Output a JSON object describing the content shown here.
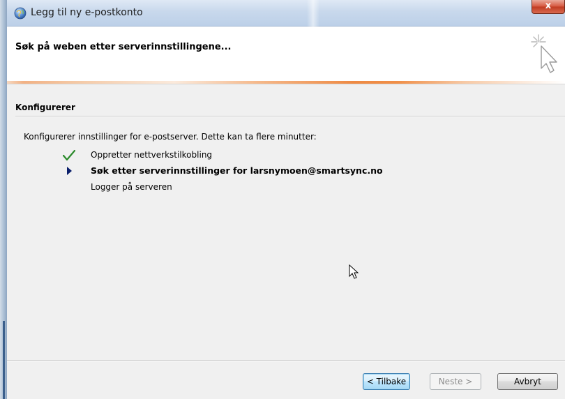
{
  "window": {
    "title": "Legg til ny e-postkonto",
    "close_label": "x"
  },
  "header": {
    "title": "Søk på weben etter serverinnstillingene..."
  },
  "section": {
    "title": "Konfigurerer",
    "intro": "Konfigurerer innstillinger for e-postserver. Dette kan ta flere minutter:"
  },
  "steps": [
    {
      "label": "Oppretter nettverkstilkobling",
      "status": "done",
      "icon": "checkmark-icon"
    },
    {
      "label": "Søk etter serverinnstillinger for larsnymoen@smartsync.no",
      "status": "active",
      "icon": "triangle-right-icon"
    },
    {
      "label": "Logger på serveren",
      "status": "pending",
      "icon": ""
    }
  ],
  "buttons": {
    "back": "< Tilbake",
    "next": "Neste >",
    "cancel": "Avbryt"
  },
  "colors": {
    "check": "#2a8a2a",
    "arrow": "#0b1f6b",
    "accent": "#ee8a44"
  }
}
